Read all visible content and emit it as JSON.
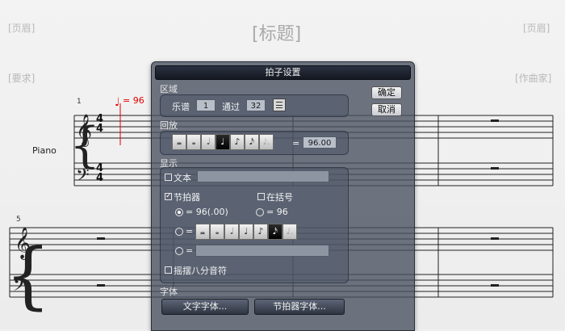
{
  "page": {
    "header_left": "[页眉]",
    "title": "[标题]",
    "header_right": "[页眉]",
    "requirement": "[要求]",
    "composer": "[作曲家]"
  },
  "score": {
    "instrument": "Piano",
    "measure1": "1",
    "measure5": "5",
    "time_sig_top": "4",
    "time_sig_bottom": "4",
    "tempo_mark": "= 96",
    "tempo_color": "#e00000"
  },
  "dialog": {
    "title": "拍子设置",
    "ok": "确定",
    "cancel": "取消",
    "range": {
      "label": "区域",
      "score_label": "乐谱",
      "score_value": "1",
      "through_label": "通过",
      "through_value": "32"
    },
    "playback": {
      "label": "回放",
      "value": "96.00",
      "equals": "="
    },
    "display": {
      "label": "显示",
      "text_label": "文本",
      "text_checked": false,
      "text_value": "",
      "metronome_label": "节拍器",
      "metronome_checked": true,
      "parentheses_label": "在括号",
      "parentheses_checked": false,
      "radio1": "= 96(.00)",
      "radio1_on": true,
      "radio2": "= 96",
      "radio2_on": false,
      "radio3": "=",
      "radio4": "=",
      "swing_label": "摇摆八分音符",
      "swing_checked": false
    },
    "font": {
      "label": "字体",
      "text_font_button": "文字字体...",
      "metronome_font_button": "节拍器字体..."
    }
  },
  "icons": {
    "note_buttons": [
      "double-whole",
      "whole",
      "half",
      "quarter",
      "eighth",
      "sixteenth",
      "dotted-quarter"
    ],
    "selected_playback_index": 3,
    "selected_display_index": 5
  }
}
